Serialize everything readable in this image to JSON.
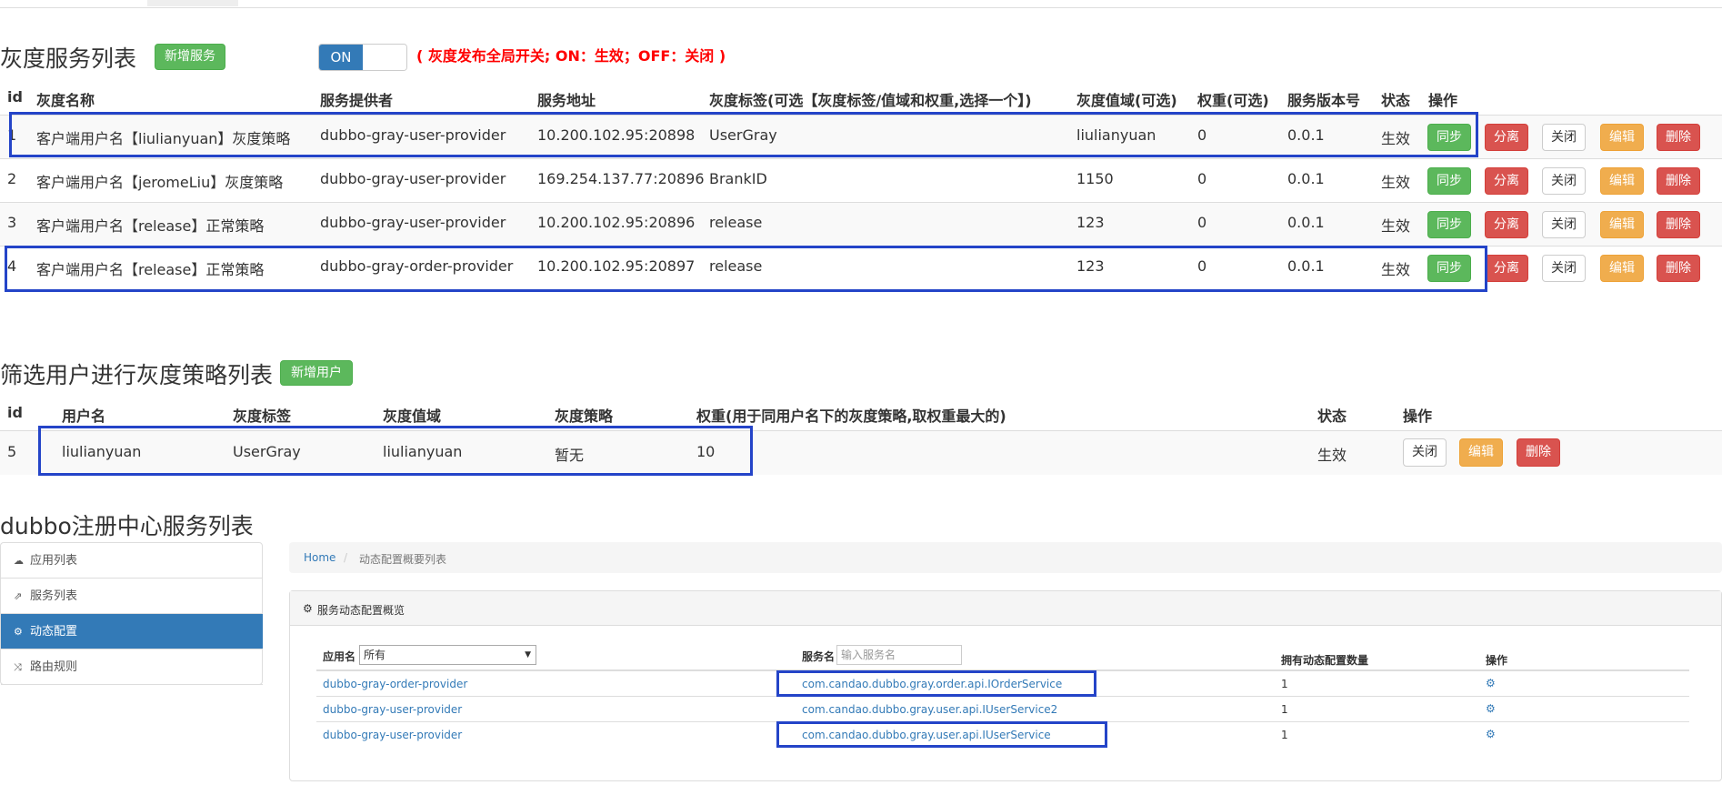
{
  "gray_services": {
    "title": "灰度服务列表",
    "add_label": "新增服务",
    "toggle_on": "ON",
    "hint": "( 灰度发布全局开关; ON：生效；OFF：关闭 )",
    "headers": [
      "id",
      "灰度名称",
      "服务提供者",
      "服务地址",
      "灰度标签(可选【灰度标签/值域和权重,选择一个】)",
      "灰度值域(可选)",
      "权重(可选)",
      "服务版本号",
      "状态",
      "操作"
    ],
    "rows": [
      {
        "id": "1",
        "name": "客户端用户名【liulianyuan】灰度策略",
        "provider": "dubbo-gray-user-provider",
        "address": "10.200.102.95:20898",
        "tag": "UserGray",
        "domain": "liulianyuan",
        "weight": "0",
        "version": "0.0.1",
        "status": "生效"
      },
      {
        "id": "2",
        "name": "客户端用户名【jeromeLiu】灰度策略",
        "provider": "dubbo-gray-user-provider",
        "address": "169.254.137.77:20896",
        "tag": "BrankID",
        "domain": "1150",
        "weight": "0",
        "version": "0.0.1",
        "status": "生效"
      },
      {
        "id": "3",
        "name": "客户端用户名【release】正常策略",
        "provider": "dubbo-gray-user-provider",
        "address": "10.200.102.95:20896",
        "tag": "release",
        "domain": "123",
        "weight": "0",
        "version": "0.0.1",
        "status": "生效"
      },
      {
        "id": "4",
        "name": "客户端用户名【release】正常策略",
        "provider": "dubbo-gray-order-provider",
        "address": "10.200.102.95:20897",
        "tag": "release",
        "domain": "123",
        "weight": "0",
        "version": "0.0.1",
        "status": "生效"
      }
    ],
    "actions": {
      "sync": "同步",
      "detach": "分离",
      "close": "关闭",
      "edit": "编辑",
      "delete": "删除"
    }
  },
  "user_filter": {
    "title": "筛选用户进行灰度策略列表",
    "add_label": "新增用户",
    "headers": [
      "id",
      "用户名",
      "灰度标签",
      "灰度值域",
      "灰度策略",
      "权重(用于同用户名下的灰度策略,取权重最大的)",
      "状态",
      "操作"
    ],
    "rows": [
      {
        "id": "5",
        "username": "liulianyuan",
        "tag": "UserGray",
        "domain": "liulianyuan",
        "strategy": "暂无",
        "weight": "10",
        "status": "生效"
      }
    ],
    "actions": {
      "close": "关闭",
      "edit": "编辑",
      "delete": "删除"
    }
  },
  "registry": {
    "title": "dubbo注册中心服务列表",
    "nav": [
      {
        "icon": "cloud-icon",
        "glyph": "☁",
        "label": "应用列表"
      },
      {
        "icon": "share-icon",
        "glyph": "⇗",
        "label": "服务列表"
      },
      {
        "icon": "cogs-icon",
        "glyph": "⚙",
        "label": "动态配置"
      },
      {
        "icon": "random-icon",
        "glyph": "⤨",
        "label": "路由规则"
      }
    ],
    "breadcrumb": {
      "home": "Home",
      "sep": "/",
      "current": "动态配置概要列表"
    },
    "panel_title": "服务动态配置概览",
    "filter": {
      "app_label": "应用名",
      "app_value": "所有",
      "service_label": "服务名",
      "service_placeholder": "输入服务名"
    },
    "headers": {
      "count": "拥有动态配置数量",
      "op": "操作"
    },
    "rows": [
      {
        "app": "dubbo-gray-order-provider",
        "service": "com.candao.dubbo.gray.order.api.IOrderService",
        "count": "1"
      },
      {
        "app": "dubbo-gray-user-provider",
        "service": "com.candao.dubbo.gray.user.api.IUserService2",
        "count": "1"
      },
      {
        "app": "dubbo-gray-user-provider",
        "service": "com.candao.dubbo.gray.user.api.IUserService",
        "count": "1"
      }
    ]
  },
  "colors": {
    "highlight": "#2444c8",
    "primary": "#337ab7",
    "success": "#5cb85c",
    "danger": "#d9534f",
    "warning": "#f0ad4e",
    "hint": "#ff0000"
  }
}
